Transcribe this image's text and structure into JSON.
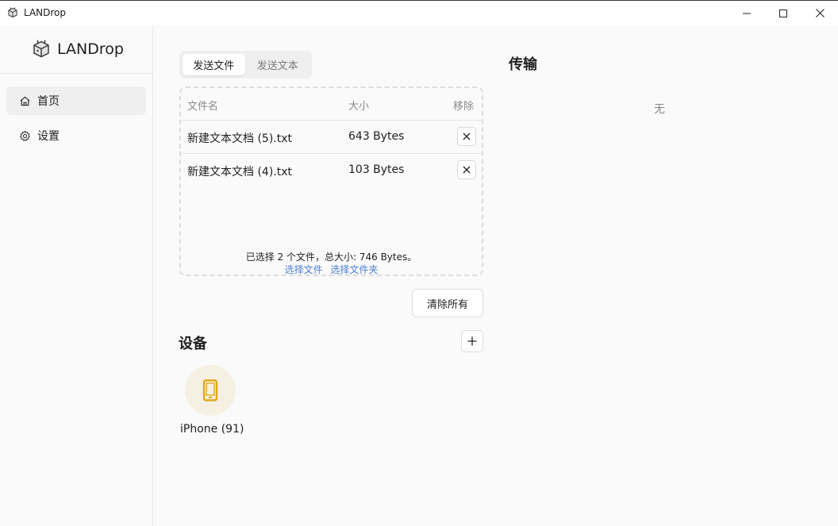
{
  "window": {
    "title": "LANDrop"
  },
  "sidebar": {
    "brand": "LANDrop",
    "items": [
      {
        "label": "首页",
        "icon": "home-icon",
        "active": true
      },
      {
        "label": "设置",
        "icon": "gear-icon",
        "active": false
      }
    ]
  },
  "send": {
    "tabs": [
      {
        "label": "发送文件",
        "active": true
      },
      {
        "label": "发送文本",
        "active": false
      }
    ],
    "columns": {
      "name": "文件名",
      "size": "大小",
      "remove": "移除"
    },
    "files": [
      {
        "name": "新建文本文档 (5).txt",
        "size": "643 Bytes"
      },
      {
        "name": "新建文本文档 (4).txt",
        "size": "103 Bytes"
      }
    ],
    "summary": "已选择 2 个文件，总大小: 746 Bytes。",
    "select_files_link": "选择文件",
    "select_folder_link": "选择文件夹",
    "clear_all_label": "清除所有"
  },
  "devices": {
    "title": "设备",
    "items": [
      {
        "name": "iPhone (91)",
        "icon": "phone-icon",
        "color": "#e0a91b"
      }
    ]
  },
  "transfer": {
    "title": "传输",
    "empty_text": "无"
  },
  "colors": {
    "link": "#4a7fd6",
    "device_accent": "#e0a91b"
  }
}
